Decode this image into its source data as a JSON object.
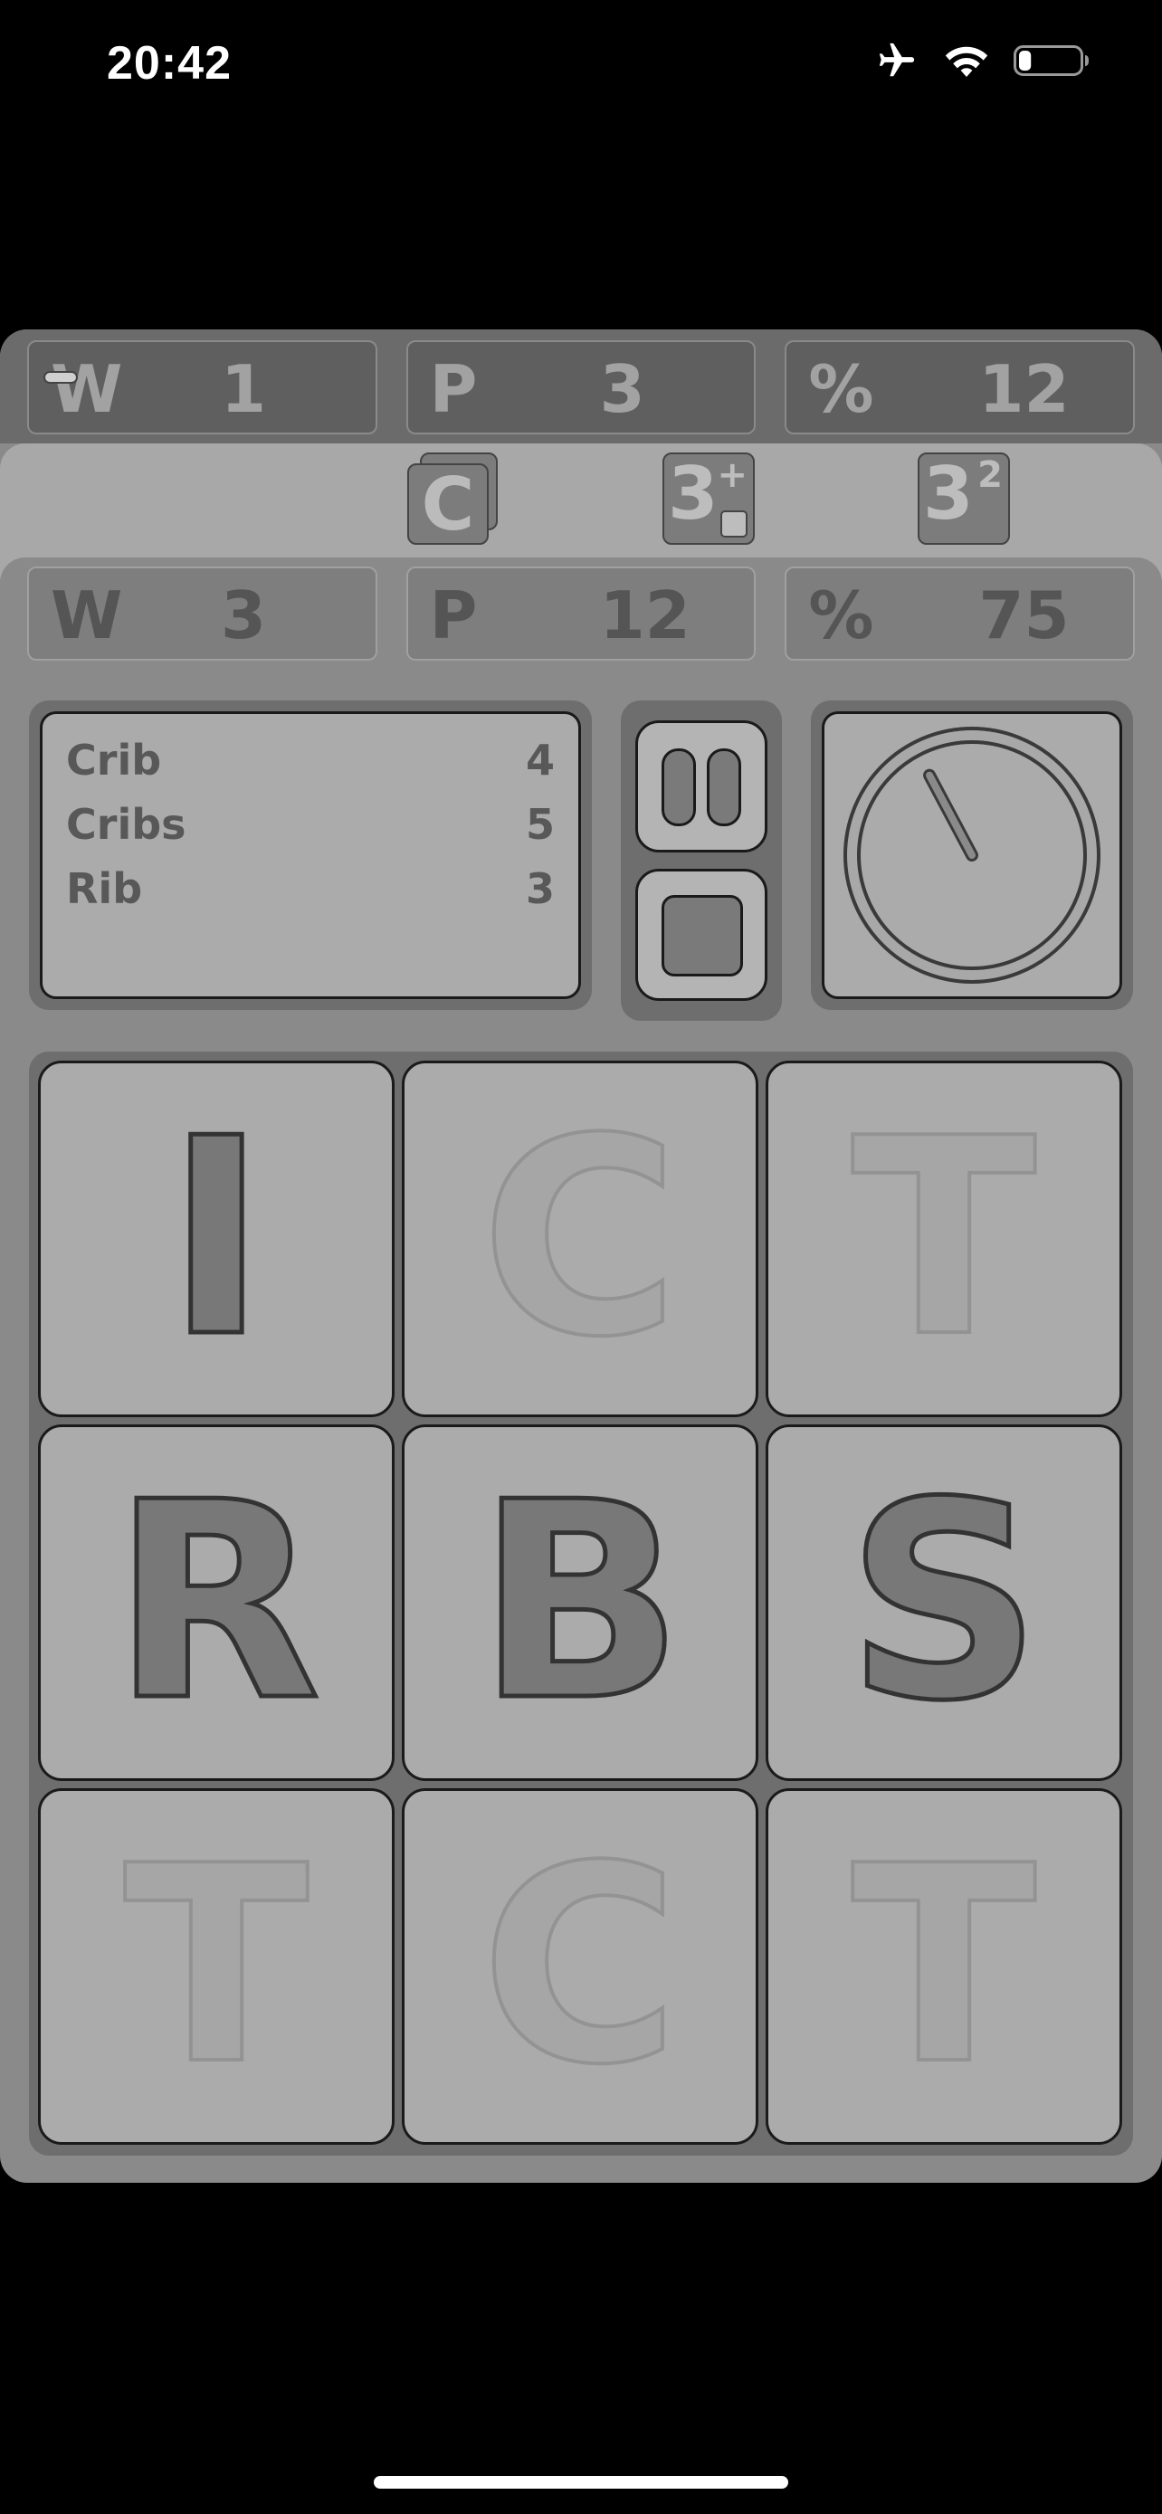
{
  "status": {
    "time": "20:42",
    "icons": [
      "airplane-icon",
      "wifi-icon",
      "battery-icon"
    ],
    "battery_level": 0.2
  },
  "top_scores": [
    {
      "label": "W",
      "value": "1"
    },
    {
      "label": "P",
      "value": "3"
    },
    {
      "label": "%",
      "value": "12"
    }
  ],
  "toolbar": {
    "copy_label": "C",
    "three_plus": {
      "base": "3",
      "sup": "+"
    },
    "three_squared": {
      "base": "3",
      "sup": "2"
    }
  },
  "bottom_scores": [
    {
      "label": "W",
      "value": "3"
    },
    {
      "label": "P",
      "value": "12"
    },
    {
      "label": "%",
      "value": "75"
    }
  ],
  "found_words": [
    {
      "word": "Crib",
      "points": "4"
    },
    {
      "word": "Cribs",
      "points": "5"
    },
    {
      "word": "Rib",
      "points": "3"
    }
  ],
  "timer": {
    "hand_angle_deg": -28
  },
  "board": [
    {
      "letter": "I",
      "state": "active"
    },
    {
      "letter": "C",
      "state": "faded"
    },
    {
      "letter": "T",
      "state": "faded"
    },
    {
      "letter": "R",
      "state": "active"
    },
    {
      "letter": "B",
      "state": "active"
    },
    {
      "letter": "S",
      "state": "active"
    },
    {
      "letter": "T",
      "state": "faded"
    },
    {
      "letter": "C",
      "state": "faded"
    },
    {
      "letter": "T",
      "state": "faded"
    }
  ],
  "colors": {
    "panel": "#8a8a8a",
    "tile": "#ababab",
    "active_letter": "#787878",
    "faded_letter": "#a6a6a6"
  }
}
